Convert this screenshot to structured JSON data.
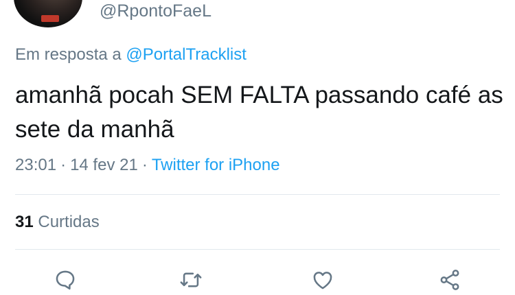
{
  "tweet": {
    "handle": "@RpontoFaeL",
    "reply_prefix": "Em resposta a",
    "reply_mention": "@PortalTracklist",
    "text": "amanhã pocah SEM FALTA passando café as sete da manhã",
    "time": "23:01",
    "date": "14 fev 21",
    "source": "Twitter for iPhone",
    "likes_count": "31",
    "likes_label": "Curtidas"
  },
  "actions": [
    {
      "name": "reply",
      "icon": "comment-icon"
    },
    {
      "name": "retweet",
      "icon": "retweet-icon"
    },
    {
      "name": "like",
      "icon": "heart-icon"
    },
    {
      "name": "share",
      "icon": "share-icon"
    }
  ],
  "colors": {
    "text_primary": "#14171a",
    "text_secondary": "#657786",
    "accent": "#1da1f2",
    "divider": "#e1e8ed"
  }
}
